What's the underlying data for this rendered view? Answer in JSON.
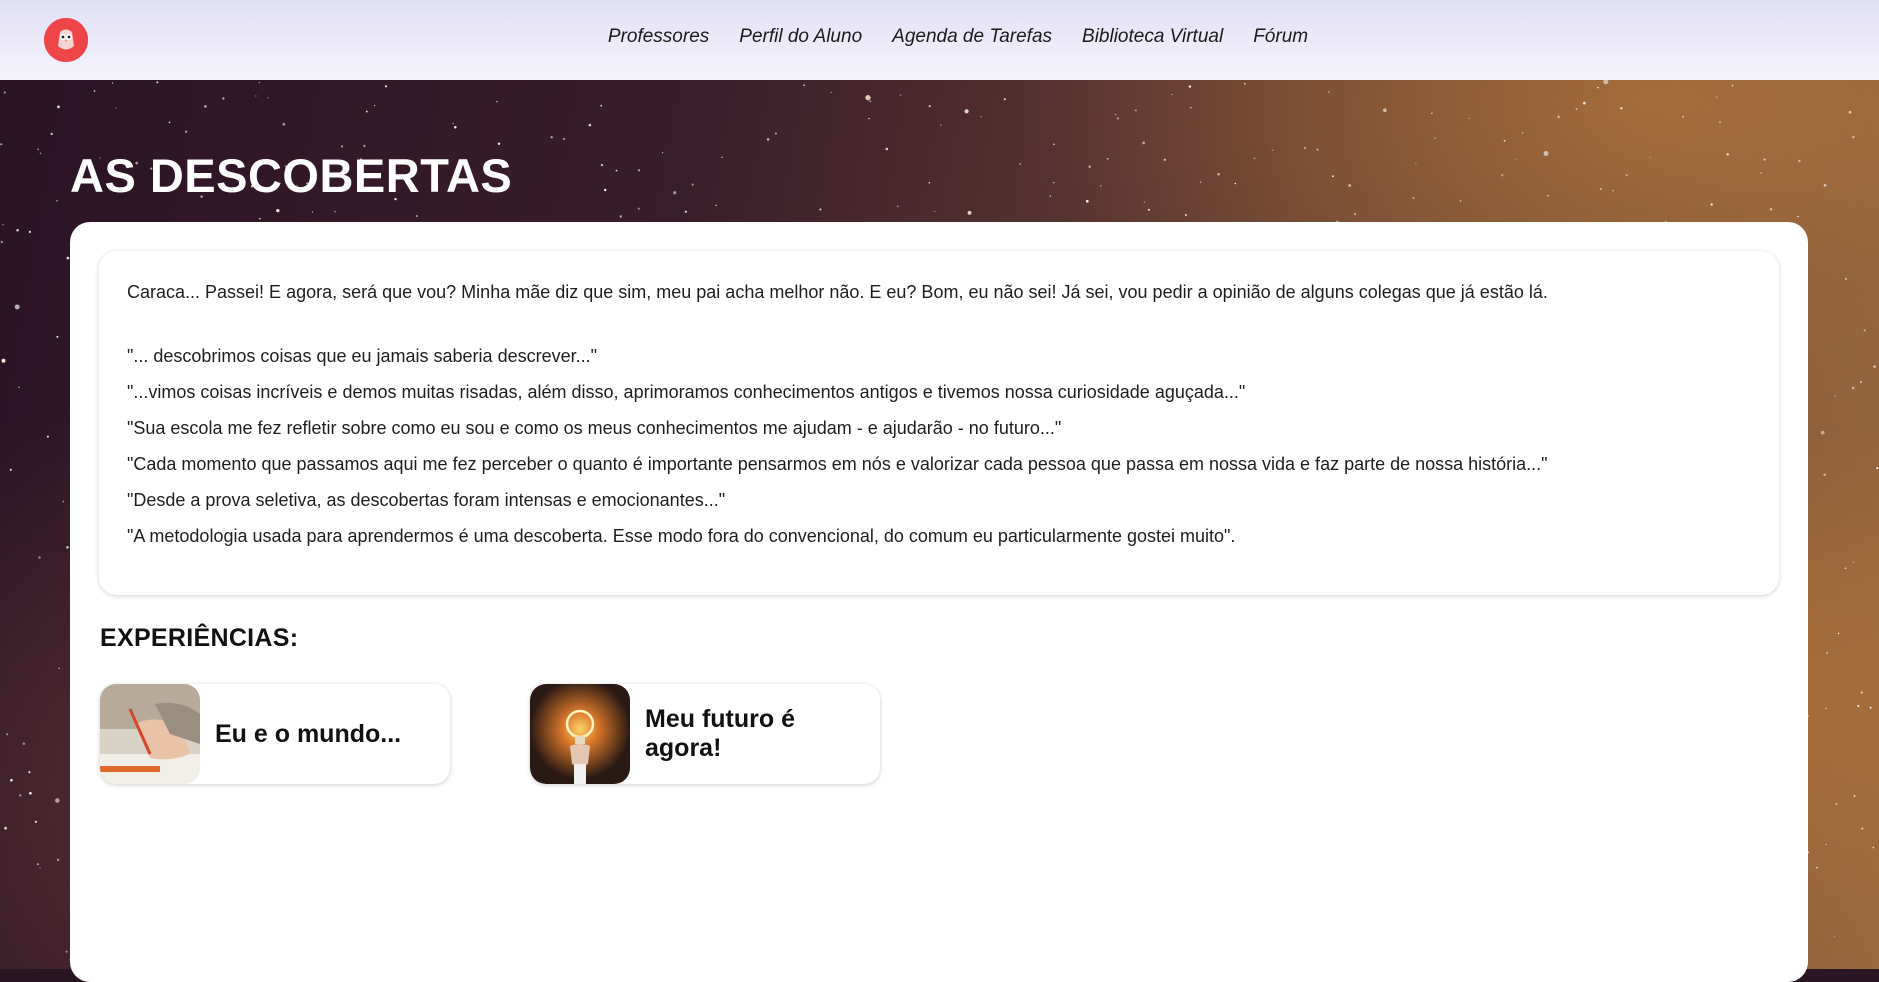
{
  "header": {
    "logo_icon": "owl-logo-icon",
    "nav": [
      {
        "label": "Professores"
      },
      {
        "label": "Perfil do Aluno"
      },
      {
        "label": "Agenda de Tarefas"
      },
      {
        "label": "Biblioteca Virtual"
      },
      {
        "label": "Fórum"
      }
    ]
  },
  "page": {
    "title": "AS DESCOBERTAS"
  },
  "content": {
    "intro": "Caraca... Passei! E agora, será que vou? Minha mãe diz que sim, meu pai acha melhor não. E eu? Bom, eu não sei! Já sei, vou pedir a opinião de alguns colegas que já estão lá.",
    "quotes": [
      "\"... descobrimos coisas que eu jamais saberia descrever...\"",
      "\"...vimos coisas incríveis e demos muitas risadas, além disso, aprimoramos conhecimentos antigos e tivemos nossa curiosidade aguçada...\"",
      "\"Sua escola me fez refletir sobre como eu sou e como os meus conhecimentos me ajudam - e ajudarão - no futuro...\"",
      "\"Cada momento que passamos aqui me fez perceber o quanto é importante pensarmos em nós e valorizar cada pessoa que passa em nossa vida e faz parte de nossa história...\"",
      "\"Desde a prova seletiva, as descobertas foram intensas e emocionantes...\"",
      "\"A metodologia usada para aprendermos é uma descoberta. Esse modo fora do convencional, do comum eu particularmente gostei muito\"."
    ]
  },
  "experiences": {
    "title": "EXPERIÊNCIAS:",
    "items": [
      {
        "label": "Eu e o mundo...",
        "image": "writing-hand-image"
      },
      {
        "label": "Meu futuro é agora!",
        "image": "lightbulb-hand-image"
      }
    ]
  },
  "colors": {
    "header_bg": "#e2e0f6",
    "logo": "#ef4548",
    "panel_bg": "#ffffff",
    "text": "#1e1e1e"
  }
}
